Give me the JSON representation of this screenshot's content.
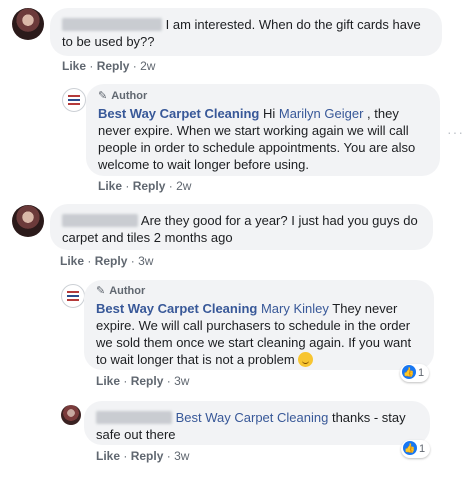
{
  "comments": [
    {
      "text": "I am interested. When do the gift cards have to be used by??",
      "actions": {
        "like": "Like",
        "reply": "Reply",
        "time": "2w"
      },
      "reply": {
        "author_tag": "Author",
        "page_name": "Best Way Carpet Cleaning",
        "pre": "Hi",
        "mention": "Marilyn Geiger",
        "text": ", they never expire. When we start working again we will call people in order to schedule appointments. You are also welcome to wait longer before using.",
        "actions": {
          "like": "Like",
          "reply": "Reply",
          "time": "2w"
        }
      }
    },
    {
      "text": "Are they good for a year? I just had you guys do carpet and tiles 2 months ago",
      "actions": {
        "like": "Like",
        "reply": "Reply",
        "time": "3w"
      },
      "reply": {
        "author_tag": "Author",
        "page_name": "Best Way Carpet Cleaning",
        "mention": "Mary Kinley",
        "text": "They never expire. We will call purchasers to schedule in the order we sold them once we start cleaning again. If you want to wait longer that is not a problem",
        "emoji": "slightly-smiling-face",
        "actions": {
          "like": "Like",
          "reply": "Reply",
          "time": "3w"
        },
        "reaction_count": "1"
      },
      "reply2": {
        "mention": "Best Way Carpet Cleaning",
        "text": "thanks - stay safe out there",
        "actions": {
          "like": "Like",
          "reply": "Reply",
          "time": "3w"
        },
        "reaction_count": "1"
      }
    }
  ],
  "more_options": "···",
  "separator": "·",
  "icons": {
    "author": "pencil-icon",
    "reaction": "thumbs-up-icon",
    "like_color": "#1877f2",
    "name_color": "#385898"
  }
}
